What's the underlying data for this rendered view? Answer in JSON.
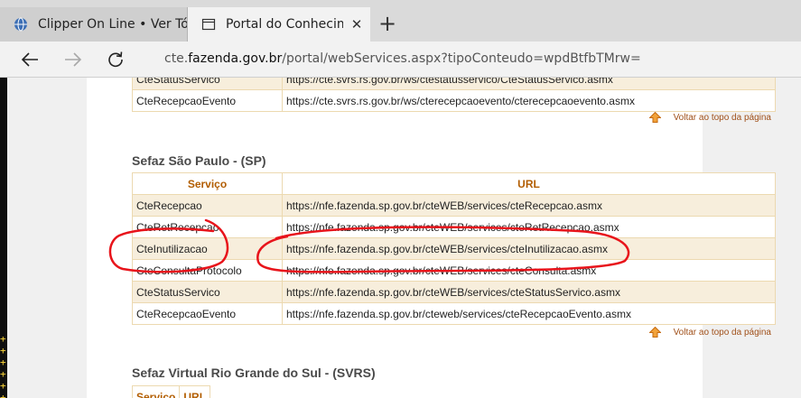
{
  "browser": {
    "tabs": [
      {
        "label": "Clipper On Line • Ver Tópico",
        "active": false
      },
      {
        "label": "Portal do Conhecimento",
        "active": true
      }
    ],
    "new_tab_label": "+",
    "close_glyph": "✕",
    "address": {
      "prefix": "cte.",
      "host": "fazenda.gov.br",
      "path": "/portal/webServices.aspx?tipoConteudo=wpdBtfbTMrw="
    }
  },
  "page": {
    "back_to_top": "Voltar ao topo da página",
    "section_rs_tail": {
      "rows": [
        {
          "service": "CteStatusServico",
          "url": "https://cte.svrs.rs.gov.br/ws/ctestatusservico/CteStatusServico.asmx"
        },
        {
          "service": "CteRecepcaoEvento",
          "url": "https://cte.svrs.rs.gov.br/ws/cterecepcaoevento/cterecepcaoevento.asmx"
        }
      ]
    },
    "section_sp": {
      "title": "Sefaz São Paulo - (SP)",
      "headers": {
        "service": "Serviço",
        "url": "URL"
      },
      "rows": [
        {
          "service": "CteRecepcao",
          "url": "https://nfe.fazenda.sp.gov.br/cteWEB/services/cteRecepcao.asmx"
        },
        {
          "service": "CteRetRecepcao",
          "url": "https://nfe.fazenda.sp.gov.br/cteWEB/services/cteRetRecepcao.asmx"
        },
        {
          "service": "CteInutilizacao",
          "url": "https://nfe.fazenda.sp.gov.br/cteWEB/services/cteInutilizacao.asmx"
        },
        {
          "service": "CteConsultaProtocolo",
          "url": "https://nfe.fazenda.sp.gov.br/cteWEB/services/cteConsulta.asmx"
        },
        {
          "service": "CteStatusServico",
          "url": "https://nfe.fazenda.sp.gov.br/cteWEB/services/cteStatusServico.asmx"
        },
        {
          "service": "CteRecepcaoEvento",
          "url": "https://nfe.fazenda.sp.gov.br/cteweb/services/cteRecepcaoEvento.asmx"
        }
      ]
    },
    "section_svrs": {
      "title": "Sefaz Virtual Rio Grande do Sul - (SVRS)",
      "headers": {
        "service": "Serviço",
        "url": "URL"
      }
    },
    "side_glyphs": [
      "+",
      "+",
      "+",
      "+",
      "+",
      "+"
    ]
  },
  "colors": {
    "header_text": "#b25d00",
    "row_stripe": "#f7eedc",
    "cell_border": "#ecd9b0",
    "annotation_red": "#e8141b",
    "link": "#a0501a"
  },
  "icons": {
    "tab1": "site-favicon-icon",
    "tab2": "page-tab-icon",
    "back": "back-arrow-icon",
    "forward": "forward-arrow-icon",
    "refresh": "refresh-icon",
    "back_to_top": "up-arrow-icon"
  }
}
